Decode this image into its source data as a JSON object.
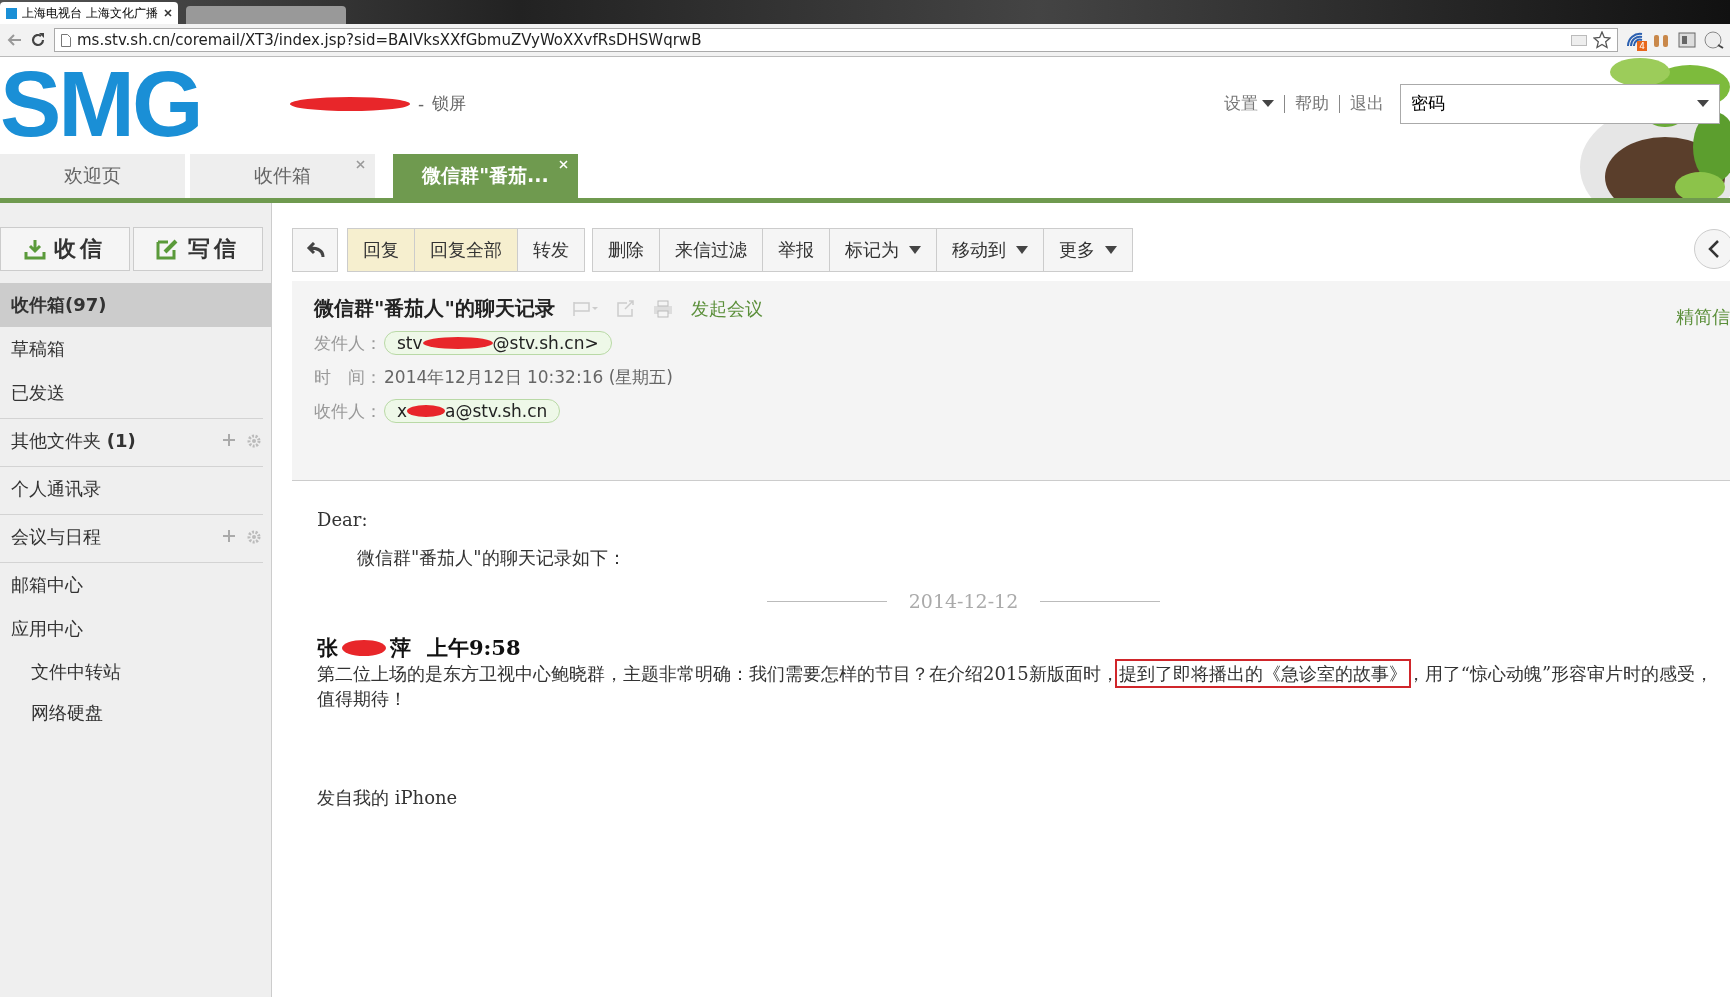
{
  "browser": {
    "tab_title": "上海电视台 上海文化广播",
    "url": "ms.stv.sh.cn/coremail/XT3/index.jsp?sid=BAIVksXXfGbmuZVyWoXXvfRsDHSWqrwB",
    "extension_badge": "4"
  },
  "header": {
    "logo": "SMG",
    "separator": "-",
    "lock": "锁屏",
    "links": [
      {
        "label": "设置",
        "dropdown": true
      },
      {
        "label": "帮助",
        "dropdown": false
      },
      {
        "label": "退出",
        "dropdown": false
      }
    ],
    "search": {
      "value": "密码"
    }
  },
  "tabs": [
    {
      "label": "欢迎页",
      "selected": false,
      "closable": false
    },
    {
      "label": "收件箱",
      "selected": false,
      "closable": true
    },
    {
      "label": "微信群\"番茄...",
      "selected": true,
      "closable": true
    }
  ],
  "sidebar": {
    "receive": "收信",
    "compose": "写信",
    "items": [
      {
        "label": "收件箱(97)",
        "selected": true,
        "has_actions": false,
        "divider": false
      },
      {
        "label": "草稿箱",
        "selected": false,
        "has_actions": false,
        "divider": false
      },
      {
        "label": "已发送",
        "selected": false,
        "has_actions": false,
        "divider": false
      },
      {
        "label": "其他文件夹 **(1)**",
        "selected": false,
        "has_actions": true,
        "divider": true
      },
      {
        "label": "个人通讯录",
        "selected": false,
        "has_actions": false,
        "divider": true
      },
      {
        "label": "会议与日程",
        "selected": false,
        "has_actions": true,
        "divider": true
      },
      {
        "label": "邮箱中心",
        "selected": false,
        "has_actions": false,
        "divider": true
      },
      {
        "label": "应用中心",
        "selected": false,
        "has_actions": false,
        "divider": false,
        "children": [
          {
            "label": "文件中转站",
            "selected": false,
            "has_actions": false,
            "divider": false
          },
          {
            "label": "网络硬盘",
            "selected": false,
            "has_actions": false,
            "divider": false
          }
        ]
      }
    ]
  },
  "toolbar": {
    "groups": [
      [
        {
          "label": "回复",
          "highlighted": true,
          "dropdown": false
        },
        {
          "label": "回复全部",
          "highlighted": true,
          "dropdown": false
        },
        {
          "label": "转发",
          "highlighted": false,
          "dropdown": false
        }
      ],
      [
        {
          "label": "删除",
          "highlighted": false,
          "dropdown": false
        },
        {
          "label": "来信过滤",
          "highlighted": false,
          "dropdown": false
        },
        {
          "label": "举报",
          "highlighted": false,
          "dropdown": false
        },
        {
          "label": "标记为",
          "highlighted": false,
          "dropdown": true
        },
        {
          "label": "移动到",
          "highlighted": false,
          "dropdown": true
        },
        {
          "label": "更多",
          "highlighted": false,
          "dropdown": true
        }
      ]
    ]
  },
  "message": {
    "subject": "微信群\"番茄人\"的聊天记录",
    "meeting": "发起会议",
    "brief": "精简信",
    "fields": [
      {
        "label": "发件人：",
        "kind": "chip",
        "value": "stv",
        "value_end": "@stv.sh.cn>"
      },
      {
        "label": "时　间：",
        "kind": "text",
        "value": "2014年12月12日 10:32:16 (星期五)"
      },
      {
        "label": "收件人：",
        "kind": "chip",
        "value": "x",
        "value_end": "a@stv.sh.cn"
      }
    ],
    "body": {
      "greeting": "Dear:",
      "intro": "微信群\"番茄人\"的聊天记录如下：",
      "date": "2014-12-12",
      "sender_start": "张",
      "sender_end": "萍",
      "time": "上午9:58",
      "text_before": "第二位上场的是东方卫视中心鲍晓群，主题非常明确：我们需要怎样的节目？在介绍2015新版面时，",
      "text_marked": "提到了即将播出的《急诊室的故事》",
      "text_after": "，用了“惊心动魄”形容审片时的感受，值得期待！",
      "signature": "发自我的 iPhone"
    }
  }
}
